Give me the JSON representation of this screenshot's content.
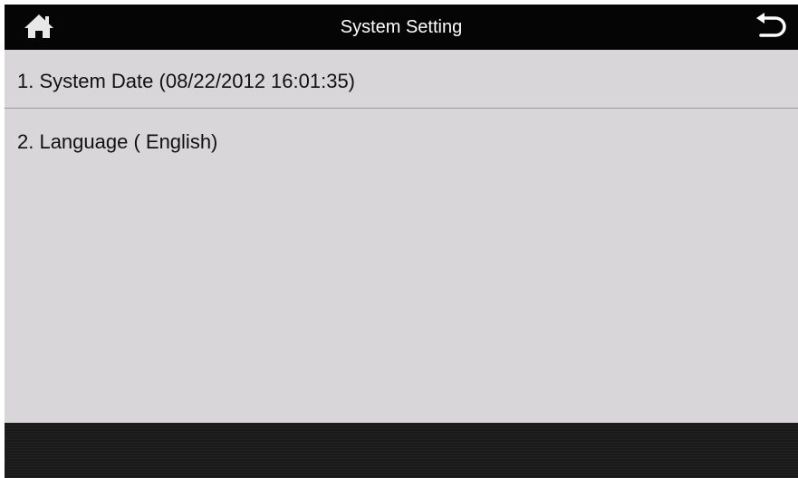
{
  "header": {
    "title": "System Setting",
    "home_icon": "home-icon",
    "back_icon": "back-arrow-icon"
  },
  "menu": {
    "items": [
      {
        "label": "1. System Date (08/22/2012 16:01:35)"
      },
      {
        "label": "2. Language ( English)"
      }
    ]
  },
  "colors": {
    "header_bg": "#050505",
    "content_bg": "#d8d6d9",
    "footer_bg": "#1a1a1a",
    "text": "#111111",
    "divider": "#9c9a9d"
  }
}
